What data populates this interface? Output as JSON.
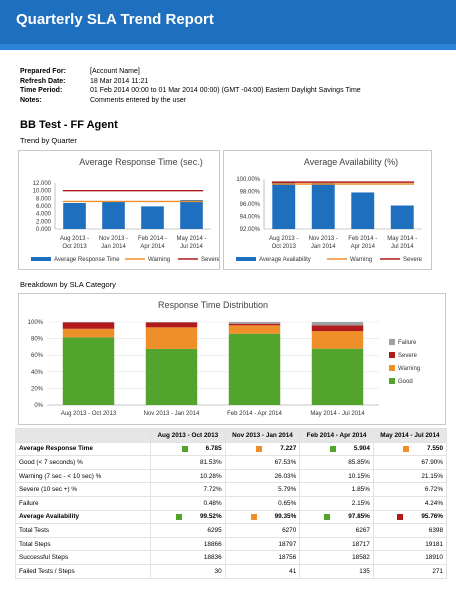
{
  "header": {
    "title": "Quarterly SLA Trend Report"
  },
  "meta": [
    {
      "key": "Prepared For:",
      "value": "[Account Name]"
    },
    {
      "key": "Refresh Date:",
      "value": "18 Mar 2014 11:21"
    },
    {
      "key": "Time Period:",
      "value": "01 Feb 2014 00:00 to 01 Mar 2014 00:00) (GMT -04:00) Eastern Daylight Savings Time"
    },
    {
      "key": "Notes:",
      "value": "Comments entered by the user"
    }
  ],
  "section_title": "BB Test - FF Agent",
  "trend_label": "Trend by Quarter",
  "breakdown_label": "Breakdown by SLA Category",
  "colors": {
    "header": "#1f6fbf",
    "bar_blue": "#1f6fbf",
    "warning": "#ee8f2a",
    "severe": "#b11b1b",
    "failure": "#a0a0a0",
    "good": "#53a42c"
  },
  "chart_data": [
    {
      "type": "bar",
      "title": "Average Response Time (sec.)",
      "categories": [
        "Aug 2013 -\nOct 2013",
        "Nov 2013 -\nJan 2014",
        "Feb 2014 -\nApr 2014",
        "May 2014 -\nJul 2014"
      ],
      "series": [
        {
          "name": "Average Response Time",
          "values": [
            6.785,
            7.227,
            5.904,
            7.55
          ]
        },
        {
          "name": "Warning",
          "type": "line",
          "values": [
            7.2,
            7.2,
            7.2,
            7.2
          ]
        },
        {
          "name": "Severe",
          "type": "line",
          "values": [
            10.0,
            10.0,
            10.0,
            10.0
          ]
        }
      ],
      "yticks": [
        "12.000",
        "10.000",
        "8.000",
        "6.000",
        "4.000",
        "2.000",
        "0.000"
      ],
      "ylim": [
        0,
        12
      ],
      "legend": "bottom",
      "grid": false
    },
    {
      "type": "bar",
      "title": "Average Availability (%)",
      "categories": [
        "Aug 2013 -\nOct 2013",
        "Nov 2013 -\nJan 2014",
        "Feb 2014 -\nApr 2014",
        "May 2014 -\nJul 2014"
      ],
      "series": [
        {
          "name": "Average Availability",
          "values": [
            99.52,
            99.35,
            97.85,
            95.76
          ]
        },
        {
          "name": "Warning",
          "type": "line",
          "values": [
            99.2,
            99.2,
            99.2,
            99.2
          ]
        },
        {
          "name": "Severe",
          "type": "line",
          "values": [
            99.5,
            99.5,
            99.5,
            99.5
          ]
        }
      ],
      "yticks": [
        "100.00%",
        "98.00%",
        "96.00%",
        "94.00%",
        "92.00%"
      ],
      "ylim": [
        92,
        100
      ],
      "legend": "bottom",
      "grid": false
    },
    {
      "type": "bar",
      "stacked": true,
      "title": "Response Time Distribution",
      "categories": [
        "Aug 2013 - Oct 2013",
        "Nov 2013 - Jan 2014",
        "Feb 2014 - Apr 2014",
        "May 2014 - Jul 2014"
      ],
      "series": [
        {
          "name": "Good",
          "values": [
            81.53,
            67.53,
            85.85,
            67.9
          ]
        },
        {
          "name": "Warning",
          "values": [
            10.28,
            26.03,
            10.15,
            21.15
          ]
        },
        {
          "name": "Severe",
          "values": [
            7.72,
            5.79,
            1.85,
            6.72
          ]
        },
        {
          "name": "Failure",
          "values": [
            0.48,
            0.65,
            2.15,
            4.24
          ]
        }
      ],
      "yticks": [
        "100%",
        "80%",
        "60%",
        "40%",
        "20%",
        "0%"
      ],
      "ylim": [
        0,
        100
      ],
      "legend": "right",
      "grid": true
    }
  ],
  "table": {
    "headers": [
      "",
      "Aug 2013 - Oct 2013",
      "Nov 2013 - Jan 2014",
      "Feb 2014 - Apr 2014",
      "May 2014 - Jul 2014"
    ],
    "rows": [
      {
        "label": "Average Response Time",
        "bold": true,
        "values": [
          "6.785",
          "7.227",
          "5.904",
          "7.550"
        ],
        "status": [
          "good",
          "warning",
          "good",
          "warning"
        ]
      },
      {
        "label": "Good (< 7 seconds) %",
        "values": [
          "81.53%",
          "67.53%",
          "85.85%",
          "67.90%"
        ]
      },
      {
        "label": "Warning (7 sec - < 10 sec) %",
        "values": [
          "10.28%",
          "26.03%",
          "10.15%",
          "21.15%"
        ]
      },
      {
        "label": "Severe (10 sec +) %",
        "values": [
          "7.72%",
          "5.79%",
          "1.85%",
          "6.72%"
        ]
      },
      {
        "label": "Failure",
        "values": [
          "0.48%",
          "0.65%",
          "2.15%",
          "4.24%"
        ]
      },
      {
        "label": "Average Availability",
        "bold": true,
        "values": [
          "99.52%",
          "99.35%",
          "97.85%",
          "95.76%"
        ],
        "status": [
          "good",
          "warning",
          "good",
          "severe"
        ]
      },
      {
        "label": "Total Tests",
        "values": [
          "6295",
          "6270",
          "6267",
          "6398"
        ]
      },
      {
        "label": "Total Steps",
        "values": [
          "18866",
          "18797",
          "18717",
          "19181"
        ]
      },
      {
        "label": "Successful Steps",
        "values": [
          "18836",
          "18756",
          "18582",
          "18910"
        ]
      },
      {
        "label": "Failed Tests / Steps",
        "values": [
          "30",
          "41",
          "135",
          "271"
        ]
      }
    ]
  }
}
